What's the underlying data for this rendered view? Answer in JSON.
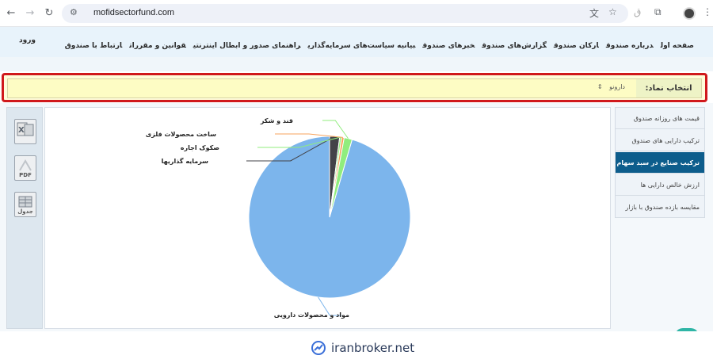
{
  "browser": {
    "url": "mofidsectorfund.com",
    "icons": [
      "back-arrow-icon",
      "forward-arrow-icon",
      "reload-icon",
      "site-info-icon",
      "translate-icon",
      "star-icon",
      "extensions-icon",
      "profile-avatar-icon",
      "menu-kebab-icon"
    ]
  },
  "site": {
    "menu": [
      "صفحه اول",
      "درباره صندوق",
      "ارکان صندوق",
      "گزارش‌های صندوق",
      "خبرهای صندوق",
      "بیانیه سیاست‌های سرمایه‌گذاری",
      "راهنمای صدور و ابطال اینترنتی",
      "قوانین و مقررات",
      "ارتباط با صندوق"
    ],
    "login": "ورود"
  },
  "symbol": {
    "label": "انتخاب نماد:",
    "selected": "دارونو"
  },
  "tools": {
    "pdf_label": "PDF",
    "table_label": "جدول"
  },
  "sidebar": {
    "items": [
      "قیمت های روزانه صندوق",
      "ترکیب دارایی های صندوق",
      "ترکیب صنایع در سبد سهام",
      "ارزش خالص دارایی ها",
      "مقایسه بازده صندوق با بازار"
    ],
    "active_index": 2
  },
  "chart_data": {
    "type": "pie",
    "slices": [
      {
        "label": "مواد و محصولات دارویی",
        "value": 95.5,
        "color": "#7cb5ec"
      },
      {
        "label": "سرمایه گذاریها",
        "value": 2.0,
        "color": "#434348"
      },
      {
        "label": "صکوک اجاره",
        "value": 0.4,
        "color": "#90ed7d"
      },
      {
        "label": "ساخت محصولات فلزی",
        "value": 0.5,
        "color": "#f7a35c"
      },
      {
        "label": "قند و شکر",
        "value": 1.6,
        "color": "#90ed7d"
      }
    ]
  },
  "footer": {
    "brand": "iranbroker.net"
  },
  "colors": {
    "highlight_border": "#d0191c",
    "active_tab": "#0d5d8c",
    "header_bg": "#e8f3fb"
  }
}
